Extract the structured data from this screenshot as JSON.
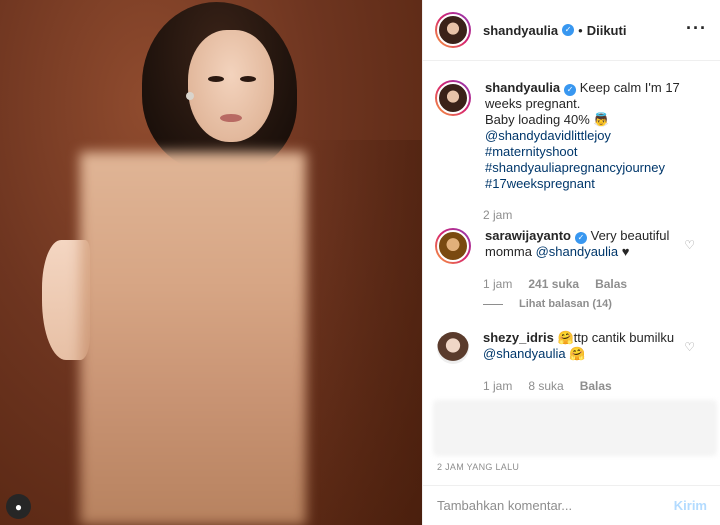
{
  "post": {
    "author": "shandyaulia",
    "follow_status": "Diikuti",
    "more_icon": "ellipsis-icon"
  },
  "caption": {
    "username": "shandyaulia",
    "line1": "Keep calm I'm 17 weeks pregnant.",
    "line2": "Baby loading 40% 👼",
    "mention": "@shandydavidlittlejoy",
    "tags": [
      "#maternityshoot",
      "#shandyauliapregnancyjourney",
      "#17weekspregnant"
    ],
    "time": "2 jam"
  },
  "comments": [
    {
      "username": "sarawijayanto",
      "text": "Very beautiful momma",
      "mention": "@shandyaulia",
      "suffix": " ♥",
      "time": "1 jam",
      "likes": "241 suka",
      "reply_label": "Balas",
      "view_replies": "Lihat balasan (14)"
    },
    {
      "username": "shezy_idris",
      "text": "🤗ttp cantik bumilku",
      "mention": "@shandyaulia",
      "suffix": " 🤗",
      "time": "1 jam",
      "likes": "8 suka",
      "reply_label": "Balas"
    }
  ],
  "footer": {
    "timestamp": "2 JAM YANG LALU",
    "comment_placeholder": "Tambahkan komentar...",
    "post_label": "Kirim"
  },
  "colors": {
    "link": "#00376b",
    "verified": "#3897f0",
    "muted": "#8e8e8e",
    "post_button_disabled": "#b3dbff"
  }
}
